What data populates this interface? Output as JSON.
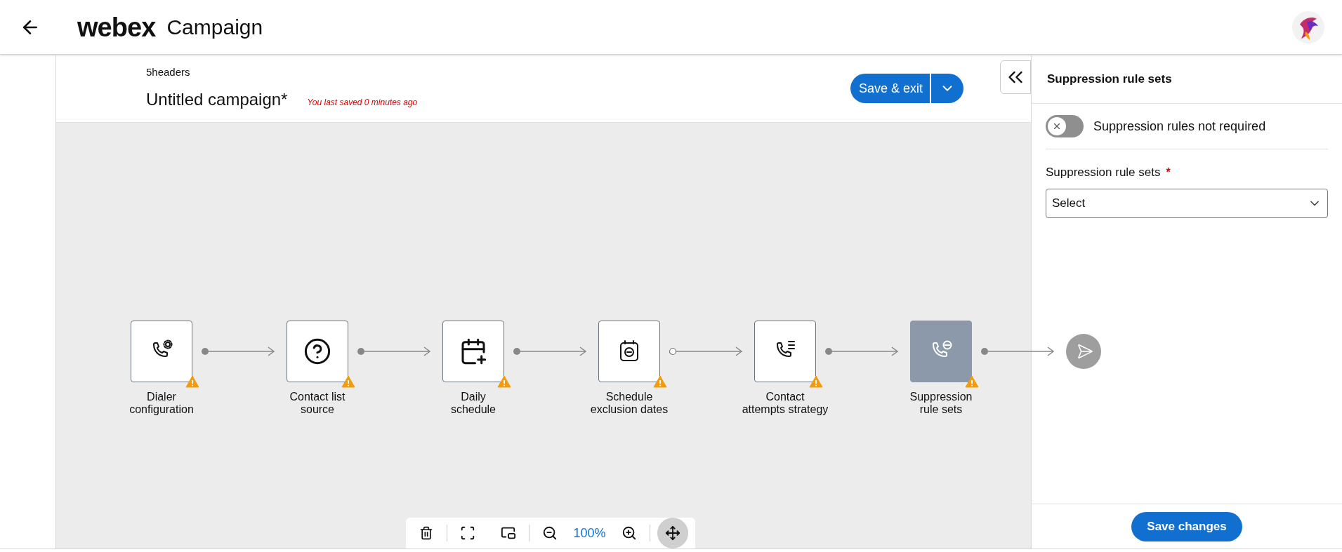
{
  "header": {
    "logo": "webex",
    "title": "Campaign"
  },
  "campaign": {
    "subtitle": "5headers",
    "name": "Untitled campaign*",
    "saved_note": "You last saved 0 minutes ago",
    "save_button": "Save & exit"
  },
  "nodes": [
    {
      "label_lines": [
        "Dialer",
        "configuration"
      ],
      "selected": false,
      "warning": true,
      "connector_start_filled": true
    },
    {
      "label_lines": [
        "Contact list",
        "source"
      ],
      "selected": false,
      "warning": true,
      "connector_start_filled": true
    },
    {
      "label_lines": [
        "Daily",
        "schedule"
      ],
      "selected": false,
      "warning": true,
      "connector_start_filled": true
    },
    {
      "label_lines": [
        "Schedule",
        "exclusion dates"
      ],
      "selected": false,
      "warning": true,
      "connector_start_filled": false
    },
    {
      "label_lines": [
        "Contact",
        "attempts strategy"
      ],
      "selected": false,
      "warning": true,
      "connector_start_filled": true
    },
    {
      "label_lines": [
        "Suppression",
        "rule sets"
      ],
      "selected": true,
      "warning": true,
      "connector_start_filled": true
    }
  ],
  "toolbar": {
    "zoom": "100%",
    "pan_selected": true
  },
  "panel": {
    "title": "Suppression rule sets",
    "toggle": {
      "label": "Suppression rules not required",
      "on": false
    },
    "field": {
      "label": "Suppression rule sets",
      "required_mark": "*",
      "value": "Select"
    },
    "save_button": "Save changes"
  }
}
